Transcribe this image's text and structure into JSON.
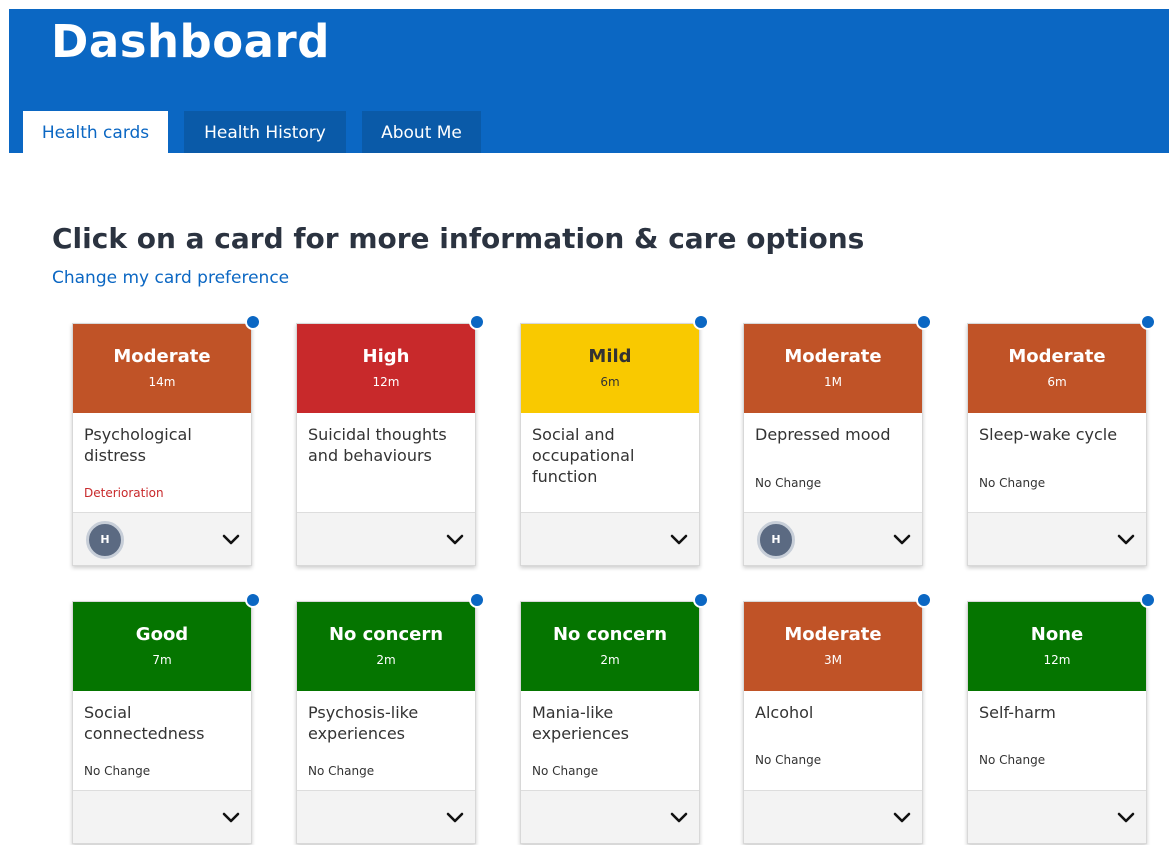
{
  "header": {
    "title": "Dashboard"
  },
  "tabs": [
    {
      "label": "Health cards"
    },
    {
      "label": "Health History"
    },
    {
      "label": "About Me"
    }
  ],
  "main": {
    "heading": "Click on a card for more information & care options",
    "preference_link": "Change my card preference"
  },
  "colors": {
    "header_blue": "#0b67c3",
    "moderate": "#c05327",
    "high": "#c8292b",
    "mild": "#f9c900",
    "good": "#057500"
  },
  "cards": [
    {
      "level": "Moderate",
      "time": "14m",
      "title": "Psychological distress",
      "status": "Deterioration",
      "avatar": "H",
      "color": "#c05327"
    },
    {
      "level": "High",
      "time": "12m",
      "title": "Suicidal thoughts and behaviours",
      "status": "",
      "avatar": "",
      "color": "#c8292b"
    },
    {
      "level": "Mild",
      "time": "6m",
      "title": "Social and occupational function",
      "status": "",
      "avatar": "",
      "color": "#f9c900"
    },
    {
      "level": "Moderate",
      "time": "1M",
      "title": "Depressed mood",
      "status": "No Change",
      "avatar": "H",
      "color": "#c05327"
    },
    {
      "level": "Moderate",
      "time": "6m",
      "title": "Sleep-wake cycle",
      "status": "No Change",
      "avatar": "",
      "color": "#c05327"
    },
    {
      "level": "Good",
      "time": "7m",
      "title": "Social connectedness",
      "status": "No Change",
      "avatar": "",
      "color": "#057500"
    },
    {
      "level": "No concern",
      "time": "2m",
      "title": "Psychosis-like experiences",
      "status": "No Change",
      "avatar": "",
      "color": "#057500"
    },
    {
      "level": "No concern",
      "time": "2m",
      "title": "Mania-like experiences",
      "status": "No Change",
      "avatar": "",
      "color": "#057500"
    },
    {
      "level": "Moderate",
      "time": "3M",
      "title": "Alcohol",
      "status": "No Change",
      "avatar": "",
      "color": "#c05327"
    },
    {
      "level": "None",
      "time": "12m",
      "title": "Self-harm",
      "status": "No Change",
      "avatar": "",
      "color": "#057500"
    }
  ]
}
